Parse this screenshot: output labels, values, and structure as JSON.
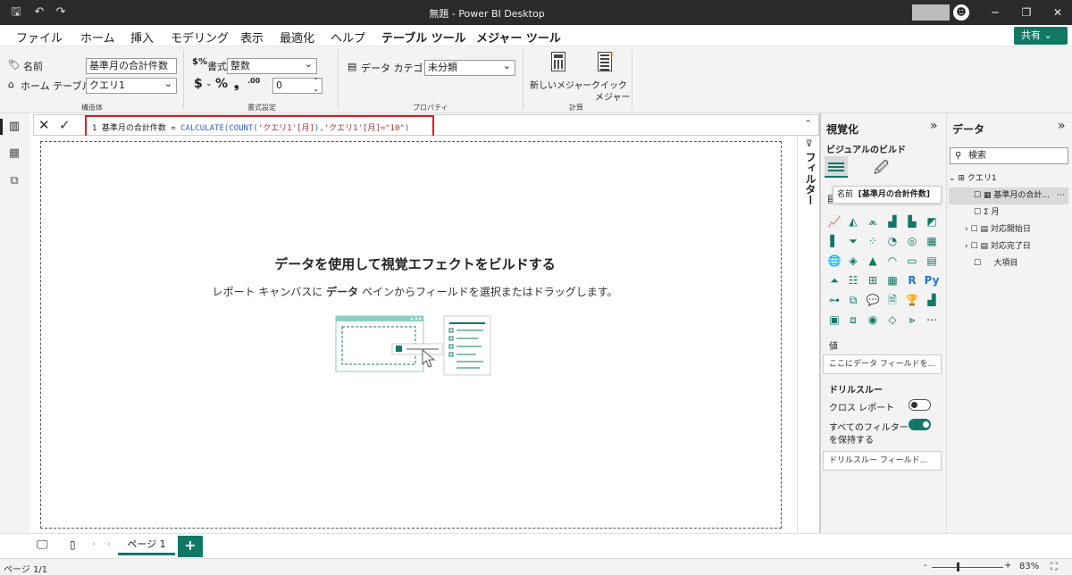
{
  "window": {
    "title": "無題 - Power BI Desktop"
  },
  "menu": {
    "items": [
      "ファイル",
      "ホーム",
      "挿入",
      "モデリング",
      "表示",
      "最適化",
      "ヘルプ"
    ],
    "context": [
      "テーブル ツール",
      "メジャー ツール"
    ],
    "share": "共有"
  },
  "ribbon": {
    "name_label": "名前",
    "name_value": "基準月の合計件数",
    "home_table_label": "ホーム テーブル",
    "home_table_value": "クエリ1",
    "group_structure": "構造体",
    "format_label": "書式",
    "format_value": "整数",
    "currency": "$",
    "percent": "%",
    "comma": "❟",
    "decimal_symbol": ".00",
    "decimal_value": "0",
    "group_format": "書式設定",
    "data_category_label": "データ カテゴリ",
    "data_category_value": "未分類",
    "group_properties": "プロパティ",
    "new_measure": "新しいメジャー",
    "quick_measure_1": "クイック",
    "quick_measure_2": "メジャー",
    "group_calc": "計算"
  },
  "formula": {
    "line_no": "1",
    "name_part": "基準月の合計件数 = ",
    "fn_part": "CALCULATE(COUNT(",
    "arg1": "'クエリ1'[月]",
    "mid": "),",
    "arg2": "'クエリ1'[月]=\"10\"",
    "end": ")"
  },
  "canvas": {
    "heading": "データを使用して視覚エフェクトをビルドする",
    "sub_pre": "レポート キャンバスに ",
    "sub_bold": "データ",
    "sub_post": " ペインからフィールドを選択またはドラッグします。"
  },
  "filters": {
    "label": "フィルター"
  },
  "viz": {
    "title": "視覚化",
    "build": "ビジュアルのビルド",
    "tooltip_label": "名前",
    "tooltip_value": "[基準月の合計件数]",
    "values_label": "値",
    "values_slot": "ここにデータ フィールドを...",
    "drill_title": "ドリルスルー",
    "cross_report": "クロス レポート",
    "cross_report_state": "off",
    "keep_filters_1": "すべてのフィルター",
    "keep_filters_2": "を保持する",
    "keep_filters_state": "on",
    "drill_slot": "ドリルスルー フィールド...",
    "more": "⋯"
  },
  "data": {
    "title": "データ",
    "search_placeholder": "検索",
    "table": "クエリ1",
    "fields": [
      {
        "name": "基準月の合計...",
        "icon": "calculator-icon"
      },
      {
        "name": "月",
        "icon": "sigma-icon"
      },
      {
        "name": "対応開始日",
        "icon": "calendar-icon"
      },
      {
        "name": "対応完了日",
        "icon": "calendar-icon"
      },
      {
        "name": "大項目",
        "icon": ""
      }
    ],
    "more": "⋯"
  },
  "pages": {
    "tab": "ページ 1",
    "add": "+"
  },
  "status": {
    "page": "ページ 1/1",
    "zoom": "83%",
    "zoom_minus": "-",
    "zoom_plus": "+"
  },
  "colors": {
    "accent": "#117865",
    "highlight": "#e31b23",
    "titlebar": "#2b2b2b"
  }
}
